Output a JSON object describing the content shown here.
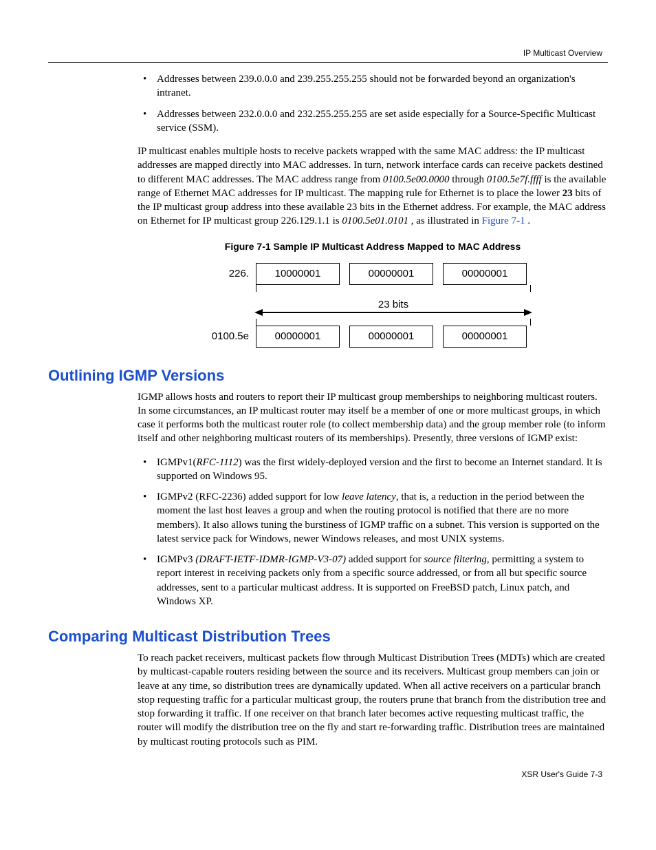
{
  "header": {
    "running": "IP Multicast Overview"
  },
  "top_bullets": [
    "Addresses between 239.0.0.0 and 239.255.255.255 should not be forwarded beyond an organization's intranet.",
    "Addresses between 232.0.0.0 and 232.255.255.255 are set aside especially for a Source-Specific Multicast service (SSM)."
  ],
  "para1": {
    "pre": "IP multicast enables multiple hosts to receive packets wrapped with the same MAC address: the IP multicast addresses are mapped directly into MAC addresses. In turn, network interface cards can receive packets destined to different MAC addresses. The MAC address range from ",
    "em1": "0100.5e00.0000",
    "mid1": " through ",
    "em2": "0100.5e7f.ffff",
    "mid2": " is the available range of Ethernet MAC addresses for IP multicast. The mapping rule for Ethernet is to place the lower ",
    "bold": "23",
    "mid3": " bits of the IP multicast group address into these available 23 bits in the Ethernet address. For example, the MAC address on Ethernet for IP multicast group 226.129.1.1 is ",
    "em3": "0100.5e01.0101",
    "mid4": ", as illustrated in ",
    "link": "Figure 7-1",
    "end": "."
  },
  "figure": {
    "caption": "Figure 7-1   Sample IP Multicast Address Mapped to MAC Address",
    "row1_label": "226.",
    "row1_cells": [
      "10000001",
      "00000001",
      "00000001"
    ],
    "bits_label": "23 bits",
    "row2_label": "0100.5e",
    "row2_cells": [
      "00000001",
      "00000001",
      "00000001"
    ]
  },
  "section_igmp": {
    "title": "Outlining IGMP Versions",
    "para": "IGMP allows hosts and routers to report their IP multicast group memberships to neighboring multicast routers. In some circumstances, an IP multicast router may itself be a member of one or more multicast groups, in which case it performs both the multicast router role (to collect membership data) and the group member role (to inform itself and other neighboring multicast routers of its memberships). Presently, three versions of IGMP exist:",
    "bullets": {
      "b1": {
        "pre": "IGMPv1(",
        "em": "RFC-1112",
        "post": ") was the first widely-deployed version and the first to become an Internet standard. It is supported on Windows 95."
      },
      "b2": {
        "pre": "IGMPv2 (RFC-2236) added support for low ",
        "em": "leave latency",
        "post": ", that is, a reduction in the period between the moment the last host leaves a group and when the routing protocol is notified that there are no more members). It also allows tuning the burstiness of IGMP traffic on a subnet. This version is supported on the latest service pack for Windows, newer Windows releases, and most UNIX systems."
      },
      "b3": {
        "pre": "IGMPv3 ",
        "em1": "(DRAFT-IETF-IDMR-IGMP-V3-07)",
        "mid": " added support for ",
        "em2": "source filtering",
        "post": ", permitting a system to report interest in receiving packets only from a specific source addressed, or from all but specific source addresses, sent to a particular multicast address. It is supported on FreeBSD patch, Linux patch, and Windows XP."
      }
    }
  },
  "section_mdt": {
    "title": "Comparing Multicast Distribution Trees",
    "para": "To reach packet receivers, multicast packets flow through Multicast Distribution Trees (MDTs) which are created by multicast-capable routers residing between the source and its receivers. Multicast group members can join or leave at any time, so distribution trees are dynamically updated. When all active receivers on a particular branch stop requesting traffic for a particular multicast group, the routers prune that branch from the distribution tree and stop forwarding it traffic. If one receiver on that branch later becomes active requesting multicast traffic, the router will modify the distribution tree on the fly and start re-forwarding traffic. Distribution trees are maintained by multicast routing protocols such as PIM."
  },
  "footer": {
    "text": "XSR User's Guide   7-3"
  }
}
